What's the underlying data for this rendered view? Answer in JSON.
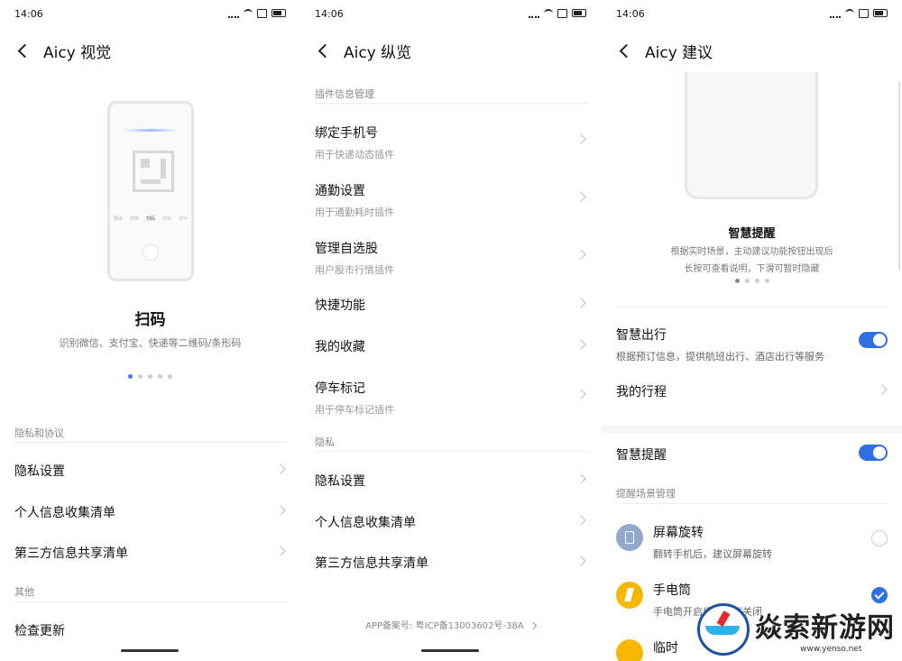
{
  "status": {
    "time": "14:06"
  },
  "screen1": {
    "title": "Aicy 视觉",
    "feature_title": "扫码",
    "feature_desc": "识别微信、支付宝、快递等二维码/条形码",
    "phone_tabs": [
      "翻译",
      "搜索",
      "扫码",
      "购物",
      "识字"
    ],
    "section_privacy": "隐私和协议",
    "items_privacy": [
      "隐私设置",
      "个人信息收集清单",
      "第三方信息共享清单"
    ],
    "section_other": "其他",
    "item_update": "检查更新"
  },
  "screen2": {
    "title": "Aicy 纵览",
    "section_plugins": "插件信息管理",
    "items": [
      {
        "t": "绑定手机号",
        "s": "用于快递动态插件"
      },
      {
        "t": "通勤设置",
        "s": "用于通勤耗时插件"
      },
      {
        "t": "管理自选股",
        "s": "用户股市行情插件"
      },
      {
        "t": "快捷功能",
        "s": ""
      },
      {
        "t": "我的收藏",
        "s": ""
      },
      {
        "t": "停车标记",
        "s": "用于停车标记插件"
      }
    ],
    "section_privacy": "隐私",
    "items_privacy": [
      "隐私设置",
      "个人信息收集清单",
      "第三方信息共享清单"
    ],
    "icp": "APP备案号: 粤ICP备13003602号-38A"
  },
  "screen3": {
    "title": "Aicy 建议",
    "feature_title": "智慧提醒",
    "feature_desc1": "根据实时场景，主动建议功能按钮出现后",
    "feature_desc2": "长按可查看说明，下滑可暂时隐藏",
    "travel_title": "智慧出行",
    "travel_desc": "根据预订信息，提供航班出行、酒店出行等服务",
    "trip": "我的行程",
    "remind_title": "智慧提醒",
    "section_scenes": "提醒场景管理",
    "scenes": [
      {
        "t": "屏幕旋转",
        "s": "翻转手机后，建议屏幕旋转"
      },
      {
        "t": "手电筒",
        "s": "手电筒开启后，建议关闭"
      },
      {
        "t": "临时",
        "s": ""
      }
    ],
    "colors": {
      "toggle": "#2f6fe4",
      "rotate_icon": "#93a8cf",
      "torch_icon": "#f5b800"
    }
  },
  "watermark": {
    "brand": "焱索新游网",
    "url": "www.yenso.net"
  }
}
